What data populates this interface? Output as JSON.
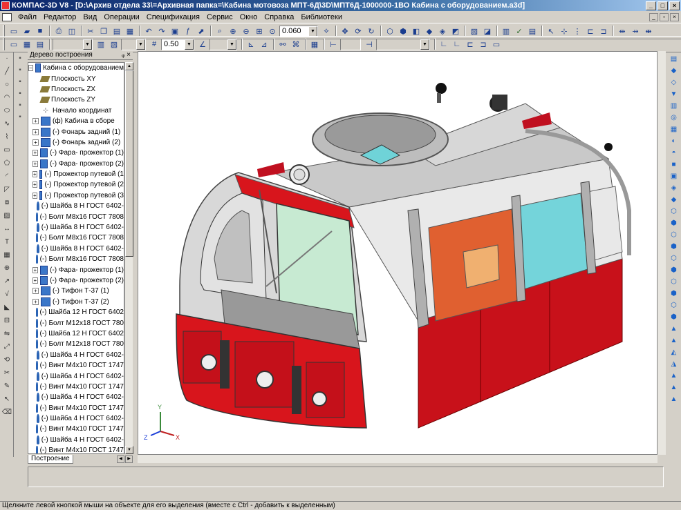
{
  "window": {
    "title": "КОМПАС-3D V8 - [D:\\Архив отдела 33\\=Архивная папка=\\Кабина мотовоза МПТ-6Д\\3D\\МПТ6Д-1000000-1ВО Кабина с оборудованием.a3d]",
    "minimize": "_",
    "maximize": "□",
    "close": "×"
  },
  "menu": {
    "items": [
      "Файл",
      "Редактор",
      "Вид",
      "Операции",
      "Спецификация",
      "Сервис",
      "Окно",
      "Справка",
      "Библиотеки"
    ]
  },
  "toolbar": {
    "zoom_value": "0.060",
    "step_value": "0.50"
  },
  "tree": {
    "header": "Дерево построения",
    "pin": "ᵩ ×",
    "root": "Кабина с оборудованием",
    "items": [
      {
        "label": "Плоскость XY",
        "icon": "plane",
        "expandable": false
      },
      {
        "label": "Плоскость ZX",
        "icon": "plane",
        "expandable": false
      },
      {
        "label": "Плоскость ZY",
        "icon": "plane",
        "expandable": false
      },
      {
        "label": "Начало координат",
        "icon": "origin",
        "expandable": false
      },
      {
        "label": "(ф) Кабина в сборе",
        "icon": "asm",
        "expandable": true
      },
      {
        "label": "(-) Фонарь задний (1)",
        "icon": "asm",
        "expandable": true
      },
      {
        "label": "(-) Фонарь задний (2)",
        "icon": "asm",
        "expandable": true
      },
      {
        "label": "(-) Фара- прожектор (1)",
        "icon": "asm",
        "expandable": true
      },
      {
        "label": "(-) Фара- прожектор (2)",
        "icon": "asm",
        "expandable": true
      },
      {
        "label": "(-) Прожектор путевой (1",
        "icon": "asm",
        "expandable": true
      },
      {
        "label": "(-) Прожектор путевой (2",
        "icon": "asm",
        "expandable": true
      },
      {
        "label": "(-) Прожектор путевой (3",
        "icon": "asm",
        "expandable": true
      },
      {
        "label": "(-) Шайба 8 Н ГОСТ 6402-",
        "icon": "part",
        "expandable": false
      },
      {
        "label": "(-) Болт М8х16 ГОСТ 7808",
        "icon": "part",
        "expandable": false
      },
      {
        "label": "(-) Шайба 8 Н ГОСТ 6402-",
        "icon": "part",
        "expandable": false
      },
      {
        "label": "(-) Болт М8х16 ГОСТ 7808",
        "icon": "part",
        "expandable": false
      },
      {
        "label": "(-) Шайба 8 Н ГОСТ 6402-",
        "icon": "part",
        "expandable": false
      },
      {
        "label": "(-) Болт М8х16 ГОСТ 7808",
        "icon": "part",
        "expandable": false
      },
      {
        "label": "(-) Фара- прожектор (1)",
        "icon": "asm",
        "expandable": true
      },
      {
        "label": "(-) Фара- прожектор (2)",
        "icon": "asm",
        "expandable": true
      },
      {
        "label": "(-) Тифон Т-37 (1)",
        "icon": "asm",
        "expandable": true
      },
      {
        "label": "(-) Тифон Т-37 (2)",
        "icon": "asm",
        "expandable": true
      },
      {
        "label": "(-) Шайба 12 Н ГОСТ 6402",
        "icon": "part",
        "expandable": false
      },
      {
        "label": "(-) Болт М12х18 ГОСТ 780",
        "icon": "part",
        "expandable": false
      },
      {
        "label": "(-) Шайба 12 Н ГОСТ 6402",
        "icon": "part",
        "expandable": false
      },
      {
        "label": "(-) Болт М12х18 ГОСТ 780",
        "icon": "part",
        "expandable": false
      },
      {
        "label": "(-) Шайба 4 Н ГОСТ 6402-",
        "icon": "part",
        "expandable": false
      },
      {
        "label": "(-) Винт М4х10 ГОСТ 1747",
        "icon": "part",
        "expandable": false
      },
      {
        "label": "(-) Шайба 4 Н ГОСТ 6402-",
        "icon": "part",
        "expandable": false
      },
      {
        "label": "(-) Винт М4х10 ГОСТ 1747",
        "icon": "part",
        "expandable": false
      },
      {
        "label": "(-) Шайба 4 Н ГОСТ 6402-",
        "icon": "part",
        "expandable": false
      },
      {
        "label": "(-) Винт М4х10 ГОСТ 1747",
        "icon": "part",
        "expandable": false
      },
      {
        "label": "(-) Шайба 4 Н ГОСТ 6402-",
        "icon": "part",
        "expandable": false
      },
      {
        "label": "(-) Винт М4х10 ГОСТ 1747",
        "icon": "part",
        "expandable": false
      },
      {
        "label": "(-) Шайба 4 Н ГОСТ 6402-",
        "icon": "part",
        "expandable": false
      },
      {
        "label": "(-) Винт М4х10 ГОСТ 1747",
        "icon": "part",
        "expandable": false
      }
    ],
    "tab": "Построение"
  },
  "viewport": {
    "axes": {
      "x": "X",
      "y": "Y",
      "z": "Z"
    },
    "colors": {
      "body_red": "#d8151c",
      "frame_grey": "#a9a9a9",
      "roof": "#cfcfcf",
      "glass": "#bfe8cf",
      "interior": "#e0602c",
      "cyan": "#6fd3d8"
    }
  },
  "status": {
    "hint": "Щелкните левой кнопкой мыши на объекте для его выделения (вместе с Ctrl - добавить к выделенным)"
  }
}
